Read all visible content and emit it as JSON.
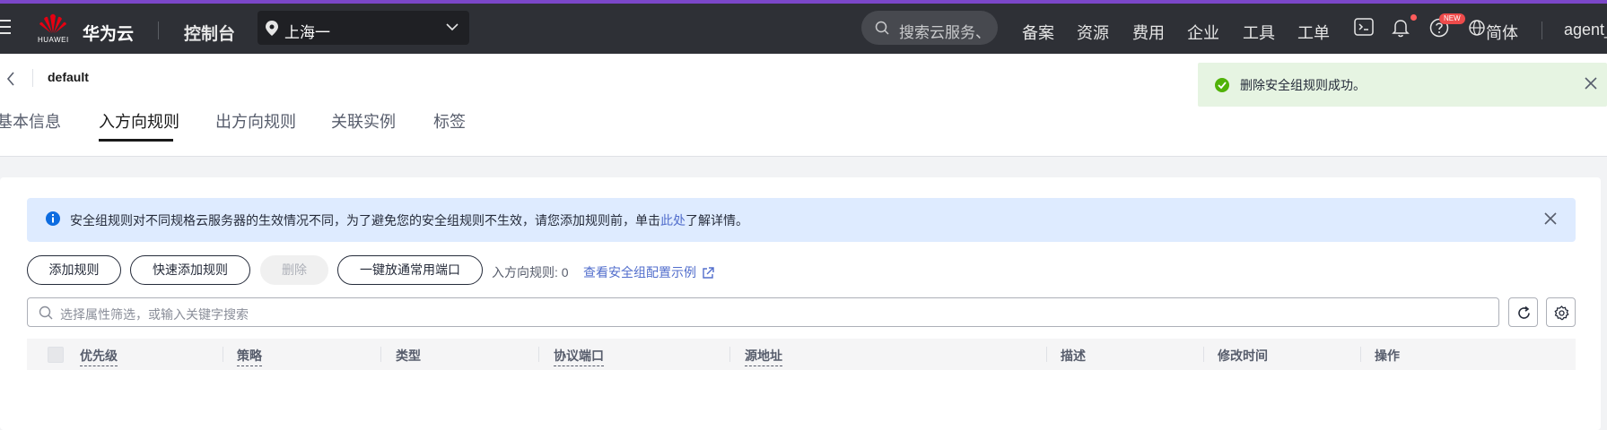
{
  "colors": {
    "accent": "#7b47c9",
    "topbar": "#2e3036",
    "link": "#526ecc",
    "success": "#50b208",
    "info": "#0d6ce0",
    "notice_bg": "#deebff",
    "toast_bg": "#e6f4e2"
  },
  "topbar": {
    "logo_caption": "HUAWEI",
    "brand": "华为云",
    "console": "控制台",
    "region": "上海一",
    "search_placeholder": "搜索云服务、",
    "nav": [
      "备案",
      "资源",
      "费用",
      "企业",
      "工具",
      "工单"
    ],
    "new_badge": "NEW",
    "language": "简体",
    "user": "agent_"
  },
  "header": {
    "resource_name": "default",
    "tabs": [
      "基本信息",
      "入方向规则",
      "出方向规则",
      "关联实例",
      "标签"
    ],
    "active_tab": "入方向规则"
  },
  "toast": {
    "message": "删除安全组规则成功。"
  },
  "notice": {
    "text_before": "安全组规则对不同规格云服务器的生效情况不同，为了避免您的安全组规则不生效，请您添加规则前，单击",
    "link": "此处",
    "text_after": "了解详情。"
  },
  "toolbar": {
    "add_rule": "添加规则",
    "quick_add_rule": "快速添加规则",
    "delete": "删除",
    "open_common_ports": "一键放通常用端口",
    "rule_count": "入方向规则: 0",
    "example_link": "查看安全组配置示例"
  },
  "filter": {
    "placeholder": "选择属性筛选，或输入关键字搜索"
  },
  "table": {
    "columns": [
      "优先级",
      "策略",
      "类型",
      "协议端口",
      "源地址",
      "描述",
      "修改时间",
      "操作"
    ]
  }
}
